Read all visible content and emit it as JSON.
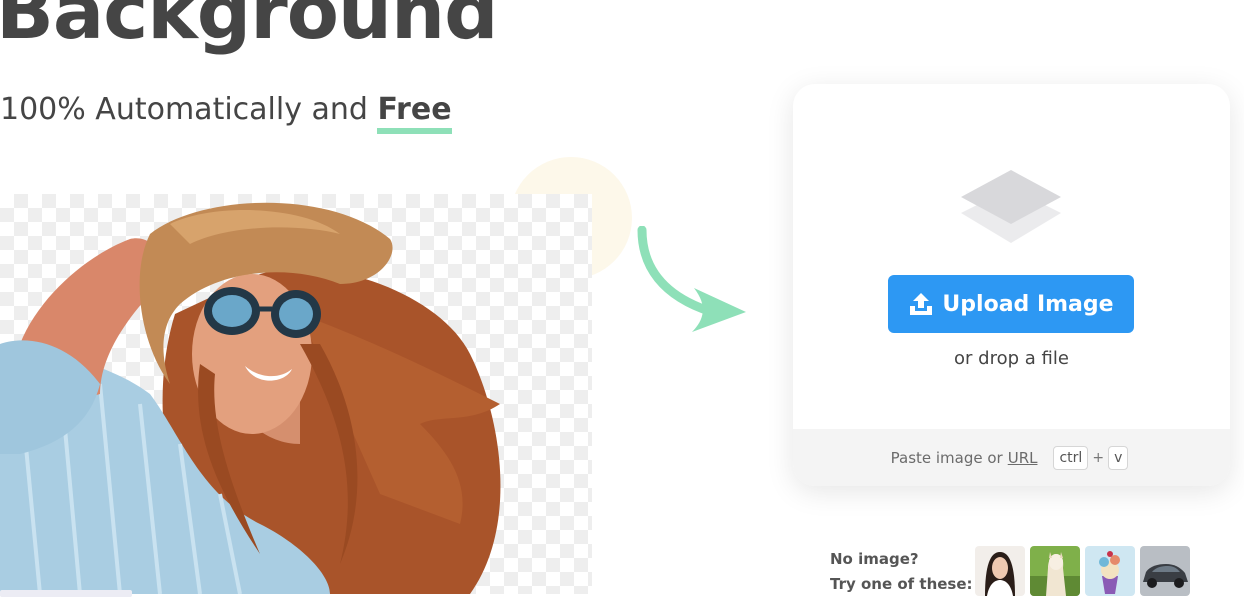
{
  "hero": {
    "headline": "Background",
    "subline_prefix": "100% Automatically and ",
    "subline_emphasis": "Free"
  },
  "upload_card": {
    "button_label": "Upload Image",
    "drop_text": "or drop a file",
    "footer_text": "Paste image or",
    "footer_link": "URL",
    "key_ctrl": "ctrl",
    "key_plus": "+",
    "key_v": "v"
  },
  "samples": {
    "line1": "No image?",
    "line2": "Try one of these:",
    "items": [
      "woman-portrait",
      "alpaca",
      "ice-cream",
      "car"
    ]
  },
  "colors": {
    "accent_blue": "#2d98f3",
    "underline_green": "#8ee0b8",
    "arrow_green": "#8ee0b8"
  }
}
